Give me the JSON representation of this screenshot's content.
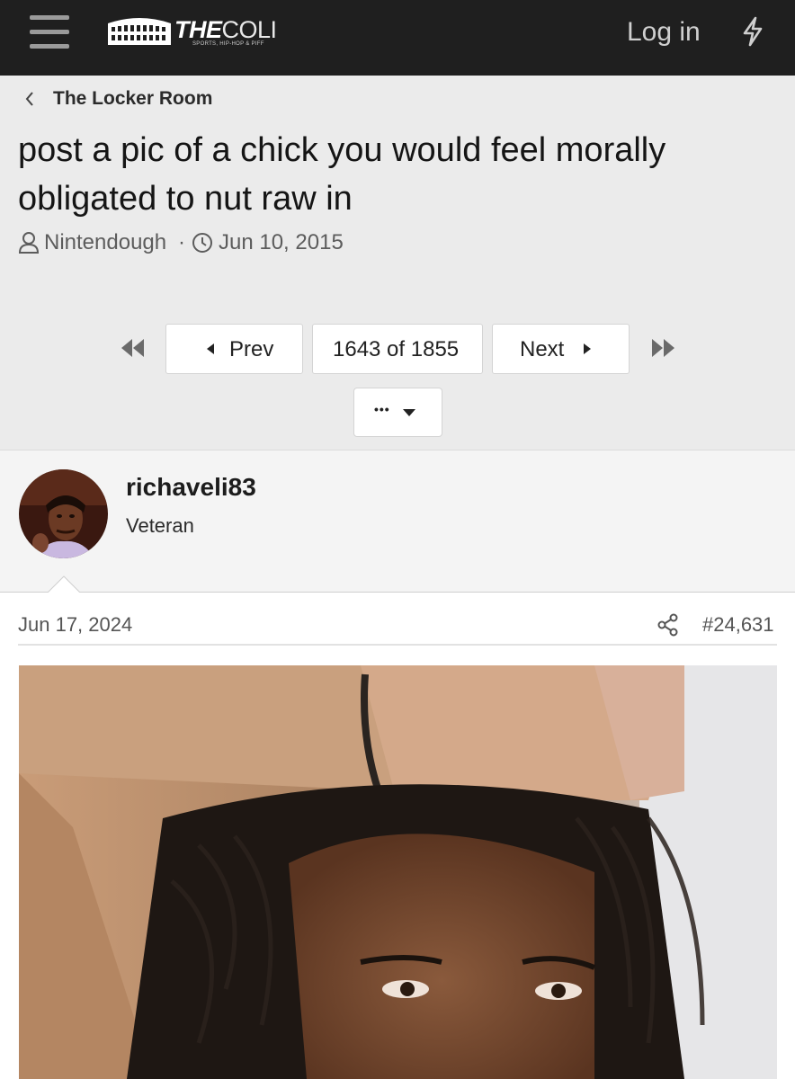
{
  "header": {
    "logo_main": "THE",
    "logo_light": "COLI",
    "logo_tagline": "SPORTS, HIP-HOP & PIFF",
    "login_label": "Log in"
  },
  "thread": {
    "breadcrumb": "The Locker Room",
    "title": "post a pic of a chick you would feel morally obligated to nut raw in",
    "author": "Nintendough",
    "separator": "·",
    "date": "Jun 10, 2015"
  },
  "pagination": {
    "prev_label": "Prev",
    "page_status": "1643 of 1855",
    "next_label": "Next",
    "more_label": "•••"
  },
  "post": {
    "username": "richaveli83",
    "user_title": "Veteran",
    "date": "Jun 17, 2024",
    "post_number": "#24,631"
  },
  "colors": {
    "topbar": "#1f1f1f",
    "header_bg": "#ebebeb",
    "post_user_bg": "#f4f4f4"
  },
  "icons": [
    "menu-icon",
    "bolt-icon",
    "chevron-left-icon",
    "user-icon",
    "clock-icon",
    "first-page-icon",
    "last-page-icon",
    "caret-down-icon",
    "share-icon"
  ]
}
